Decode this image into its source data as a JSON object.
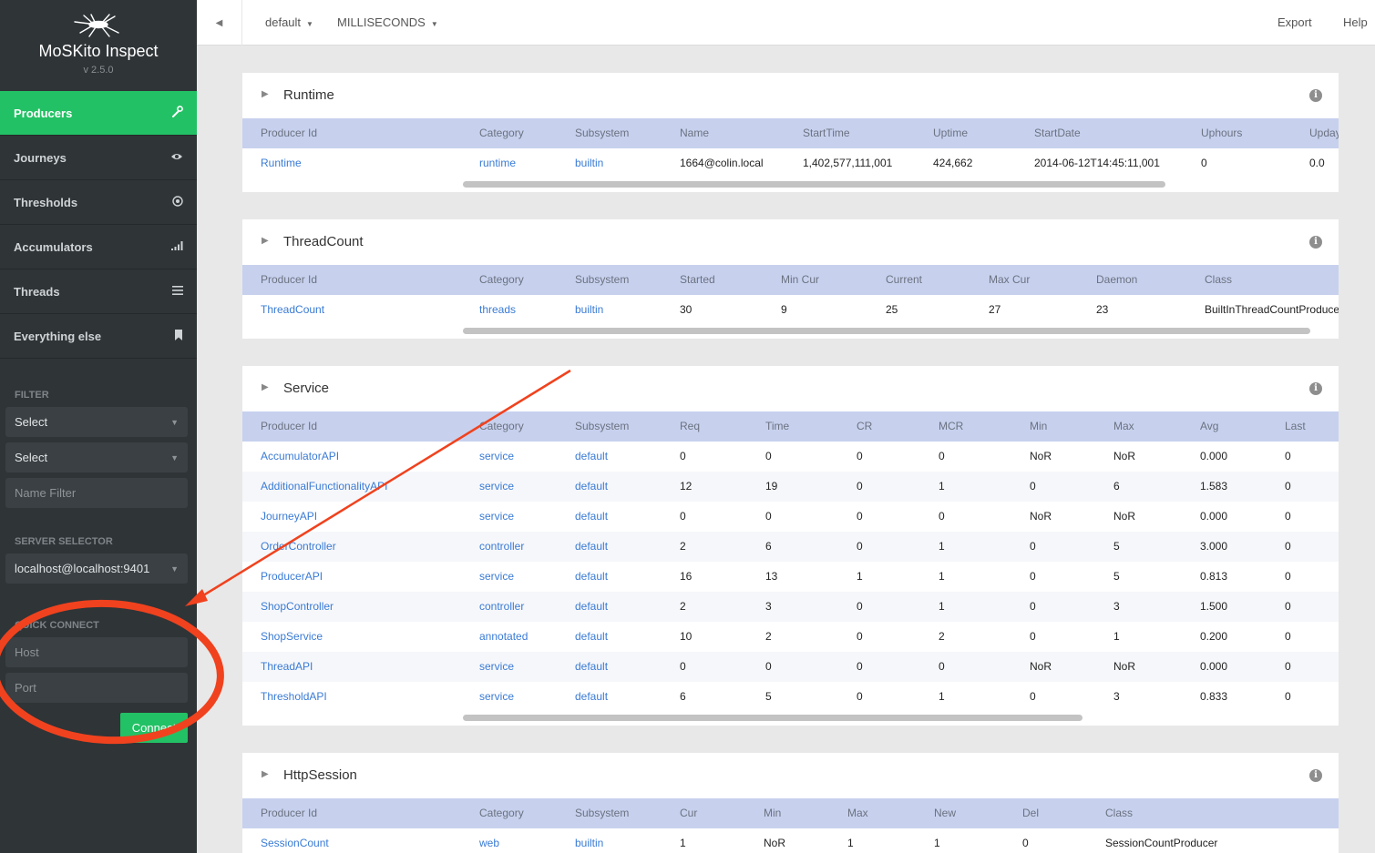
{
  "app": {
    "name": "MoSKito Inspect",
    "version": "v 2.5.0"
  },
  "sidebar": {
    "nav": [
      {
        "label": "Producers",
        "icon": "wrench-icon",
        "active": true
      },
      {
        "label": "Journeys",
        "icon": "eye-icon"
      },
      {
        "label": "Thresholds",
        "icon": "target-icon"
      },
      {
        "label": "Accumulators",
        "icon": "bar-chart-icon"
      },
      {
        "label": "Threads",
        "icon": "list-icon"
      },
      {
        "label": "Everything else",
        "icon": "bookmark-icon"
      }
    ],
    "filter_label": "FILTER",
    "filter_select_1": "Select",
    "filter_select_2": "Select",
    "name_filter_placeholder": "Name Filter",
    "server_selector_label": "SERVER SELECTOR",
    "server_value": "localhost@localhost:9401",
    "quick_connect_label": "QUICK CONNECT",
    "host_placeholder": "Host",
    "port_placeholder": "Port",
    "connect_label": "Connect"
  },
  "topbar": {
    "interval": "default",
    "unit": "MILLISECONDS",
    "export": "Export",
    "help": "Help"
  },
  "colors": {
    "accent": "#23c165",
    "sidebar": "#2f3437",
    "header_row": "#c7d1ee",
    "link": "#3a7bd5",
    "annotation": "#f0421e"
  },
  "panels": [
    {
      "title": "Runtime",
      "columns": [
        "Producer Id",
        "Category",
        "Subsystem",
        "Name",
        "StartTime",
        "Uptime",
        "StartDate",
        "Uphours",
        "Upday"
      ],
      "rows": [
        [
          "Runtime",
          "runtime",
          "builtin",
          "1664@colin.local",
          "1,402,577,111,001",
          "424,662",
          "2014-06-12T14:45:11,001",
          "0",
          "0.0"
        ]
      ]
    },
    {
      "title": "ThreadCount",
      "columns": [
        "Producer Id",
        "Category",
        "Subsystem",
        "Started",
        "Min Cur",
        "Current",
        "Max Cur",
        "Daemon",
        "Class"
      ],
      "rows": [
        [
          "ThreadCount",
          "threads",
          "builtin",
          "30",
          "9",
          "25",
          "27",
          "23",
          "BuiltInThreadCountProducer"
        ]
      ]
    },
    {
      "title": "Service",
      "columns": [
        "Producer Id",
        "Category",
        "Subsystem",
        "Req",
        "Time",
        "CR",
        "MCR",
        "Min",
        "Max",
        "Avg",
        "Last"
      ],
      "rows": [
        [
          "AccumulatorAPI",
          "service",
          "default",
          "0",
          "0",
          "0",
          "0",
          "NoR",
          "NoR",
          "0.000",
          "0"
        ],
        [
          "AdditionalFunctionalityAPI",
          "service",
          "default",
          "12",
          "19",
          "0",
          "1",
          "0",
          "6",
          "1.583",
          "0"
        ],
        [
          "JourneyAPI",
          "service",
          "default",
          "0",
          "0",
          "0",
          "0",
          "NoR",
          "NoR",
          "0.000",
          "0"
        ],
        [
          "OrderController",
          "controller",
          "default",
          "2",
          "6",
          "0",
          "1",
          "0",
          "5",
          "3.000",
          "0"
        ],
        [
          "ProducerAPI",
          "service",
          "default",
          "16",
          "13",
          "1",
          "1",
          "0",
          "5",
          "0.813",
          "0"
        ],
        [
          "ShopController",
          "controller",
          "default",
          "2",
          "3",
          "0",
          "1",
          "0",
          "3",
          "1.500",
          "0"
        ],
        [
          "ShopService",
          "annotated",
          "default",
          "10",
          "2",
          "0",
          "2",
          "0",
          "1",
          "0.200",
          "0"
        ],
        [
          "ThreadAPI",
          "service",
          "default",
          "0",
          "0",
          "0",
          "0",
          "NoR",
          "NoR",
          "0.000",
          "0"
        ],
        [
          "ThresholdAPI",
          "service",
          "default",
          "6",
          "5",
          "0",
          "1",
          "0",
          "3",
          "0.833",
          "0"
        ]
      ]
    },
    {
      "title": "HttpSession",
      "columns": [
        "Producer Id",
        "Category",
        "Subsystem",
        "Cur",
        "Min",
        "Max",
        "New",
        "Del",
        "Class"
      ],
      "rows": [
        [
          "SessionCount",
          "web",
          "builtin",
          "1",
          "NoR",
          "1",
          "1",
          "0",
          "SessionCountProducer"
        ]
      ]
    }
  ]
}
